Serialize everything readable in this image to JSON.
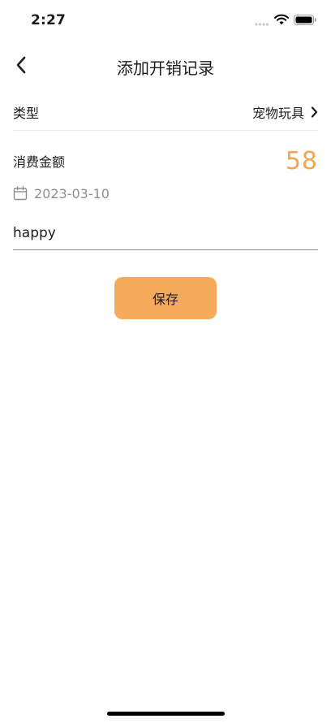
{
  "status_bar": {
    "time": "2:27"
  },
  "nav": {
    "title": "添加开销记录"
  },
  "form": {
    "type_label": "类型",
    "type_value": "宠物玩具",
    "amount_label": "消费金额",
    "amount_value": "58",
    "date": "2023-03-10",
    "note_value": "happy"
  },
  "actions": {
    "save_label": "保存"
  },
  "colors": {
    "accent": "#f6aa5b",
    "amount_text": "#f5a54f",
    "muted_text": "#8e8e93"
  }
}
